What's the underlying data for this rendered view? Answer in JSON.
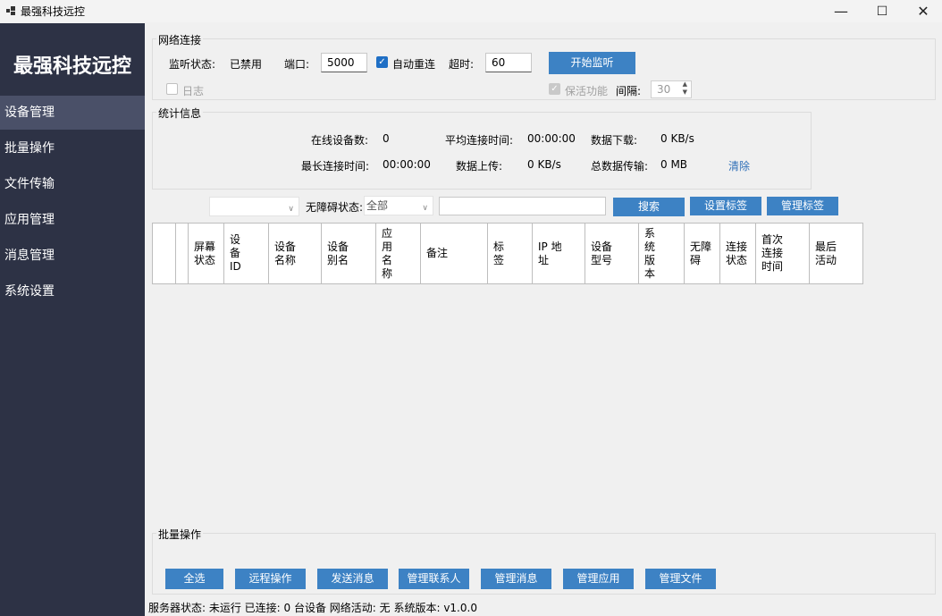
{
  "window": {
    "title": "最强科技远控",
    "controls": {
      "minimize": "—",
      "maximize": "☐",
      "close": "✕"
    }
  },
  "sidebar": {
    "brand": "最强科技远控",
    "items": [
      {
        "label": "设备管理",
        "active": true
      },
      {
        "label": "批量操作"
      },
      {
        "label": "文件传输"
      },
      {
        "label": "应用管理"
      },
      {
        "label": "消息管理"
      },
      {
        "label": "系统设置"
      }
    ]
  },
  "network": {
    "title": "网络连接",
    "listen_status_label": "监听状态:",
    "listen_status_value": "已禁用",
    "port_label": "端口:",
    "port_value": "5000",
    "auto_reconnect_label": "自动重连",
    "auto_reconnect_checked": true,
    "timeout_label": "超时:",
    "timeout_value": "60",
    "start_button": "开始监听",
    "log_label": "日志",
    "log_checked": false,
    "keepalive_label": "保活功能",
    "keepalive_checked": true,
    "interval_label": "间隔:",
    "interval_value": "30"
  },
  "stats": {
    "title": "统计信息",
    "online_label": "在线设备数:",
    "online_value": "0",
    "avg_label": "平均连接时间:",
    "avg_value": "00:00:00",
    "download_label": "数据下载:",
    "download_value": "0 KB/s",
    "max_label": "最长连接时间:",
    "max_value": "00:00:00",
    "upload_label": "数据上传:",
    "upload_value": "0 KB/s",
    "total_label": "总数据传输:",
    "total_value": "0 MB",
    "clear_link": "清除"
  },
  "filter": {
    "dropdown1_value": "",
    "accessibility_label": "无障碍状态:",
    "accessibility_value": "全部",
    "search_value": "",
    "search_button": "搜索",
    "set_tag_button": "设置标签",
    "manage_tag_button": "管理标签"
  },
  "table": {
    "columns": [
      "",
      "",
      "屏幕\n状态",
      "设\n备\nID",
      "设备\n名称",
      "设备\n别名",
      "应\n用\n名\n称",
      "备注",
      "标\n签",
      "IP 地\n址",
      "设备\n型号",
      "系\n统\n版\n本",
      "无障\n碍",
      "连接\n状态",
      "首次\n连接\n时间",
      "最后\n活动"
    ],
    "rows": []
  },
  "batch": {
    "title": "批量操作",
    "buttons": [
      "全选",
      "远程操作",
      "发送消息",
      "管理联系人",
      "管理消息",
      "管理应用",
      "管理文件"
    ]
  },
  "statusbar": {
    "text": "服务器状态: 未运行  已连接: 0 台设备  网络活动: 无  系统版本: v1.0.0"
  }
}
